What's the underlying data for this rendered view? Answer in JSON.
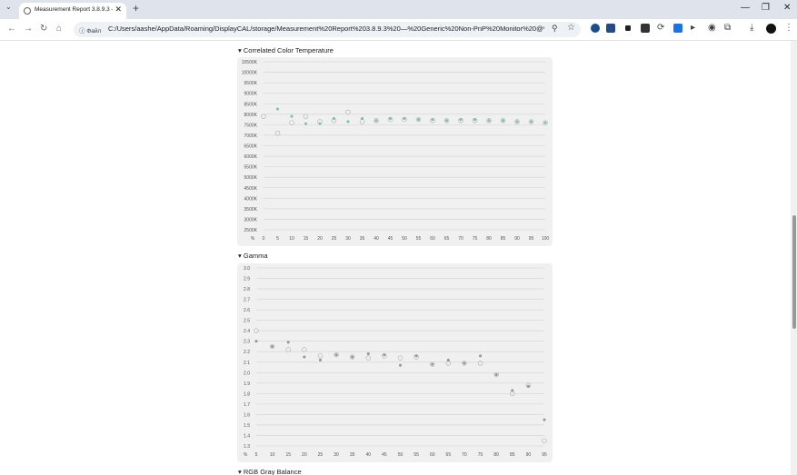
{
  "browser": {
    "tab_title": "Measurement Report 3.8.9.3 —",
    "site_label": "Файл",
    "url": "C:/Users/aashe/AppData/Roaming/DisplayCAL/storage/Measurement%20Report%203.8.9.3%20—%20Generic%20Non-PnP%20Monitor%20@%20384...",
    "ext_colors": [
      "#1a4e8a",
      "#264a86",
      "#202124",
      "#333333",
      "#1b73e8",
      "#5f6368",
      "#5f6368"
    ]
  },
  "sections": {
    "cct_title": "Correlated Color Temperature",
    "gamma_title": "Gamma",
    "rgb_title": "RGB Gray Balance"
  },
  "chart_data": [
    {
      "type": "scatter",
      "title": "Correlated Color Temperature",
      "ylim": [
        2500,
        10500
      ],
      "y_ticks": [
        "2500K",
        "3000K",
        "3500K",
        "4000K",
        "4500K",
        "5000K",
        "5500K",
        "6000K",
        "6500K",
        "7000K",
        "7500K",
        "8000K",
        "8500K",
        "9000K",
        "9500K",
        "10000K",
        "10500K"
      ],
      "x_ticks": [
        "%",
        "0",
        "5",
        "10",
        "15",
        "20",
        "25",
        "30",
        "35",
        "40",
        "45",
        "50",
        "55",
        "60",
        "65",
        "70",
        "75",
        "80",
        "85",
        "90",
        "95",
        "100"
      ],
      "grid": true,
      "series": [
        {
          "values": [
            [
              0,
              7900
            ],
            [
              5,
              7100
            ],
            [
              10,
              7600
            ],
            [
              15,
              7900
            ],
            [
              20,
              7650
            ],
            [
              25,
              7700
            ],
            [
              30,
              8100
            ],
            [
              35,
              7650
            ],
            [
              40,
              7700
            ],
            [
              45,
              7750
            ],
            [
              50,
              7750
            ],
            [
              55,
              7750
            ],
            [
              60,
              7700
            ],
            [
              65,
              7700
            ],
            [
              70,
              7700
            ],
            [
              75,
              7700
            ],
            [
              80,
              7700
            ],
            [
              85,
              7700
            ],
            [
              90,
              7650
            ],
            [
              95,
              7650
            ],
            [
              100,
              7600
            ]
          ]
        },
        {
          "values": [
            [
              5,
              8250
            ],
            [
              10,
              7900
            ],
            [
              15,
              7550
            ],
            [
              20,
              7550
            ],
            [
              25,
              7800
            ],
            [
              30,
              7650
            ],
            [
              35,
              7800
            ],
            [
              40,
              7700
            ],
            [
              45,
              7800
            ],
            [
              50,
              7800
            ],
            [
              55,
              7750
            ],
            [
              60,
              7750
            ],
            [
              65,
              7700
            ],
            [
              70,
              7750
            ],
            [
              75,
              7750
            ],
            [
              80,
              7700
            ],
            [
              85,
              7700
            ],
            [
              90,
              7650
            ],
            [
              95,
              7650
            ],
            [
              100,
              7600
            ]
          ]
        }
      ]
    },
    {
      "type": "scatter",
      "title": "Gamma",
      "ylim": [
        1.3,
        3.0
      ],
      "y_ticks": [
        "1.3",
        "1.4",
        "1.5",
        "1.6",
        "1.7",
        "1.8",
        "1.9",
        "2.0",
        "2.1",
        "2.2",
        "2.3",
        "2.4",
        "2.5",
        "2.6",
        "2.7",
        "2.8",
        "2.9",
        "3.0"
      ],
      "x_ticks": [
        "%",
        "5",
        "10",
        "15",
        "20",
        "25",
        "30",
        "35",
        "40",
        "45",
        "50",
        "55",
        "60",
        "65",
        "70",
        "75",
        "80",
        "85",
        "90",
        "95"
      ],
      "grid": true,
      "series": [
        {
          "values": [
            [
              5,
              2.4
            ],
            [
              10,
              2.25
            ],
            [
              15,
              2.22
            ],
            [
              20,
              2.22
            ],
            [
              25,
              2.16
            ],
            [
              30,
              2.17
            ],
            [
              35,
              2.15
            ],
            [
              40,
              2.14
            ],
            [
              45,
              2.16
            ],
            [
              50,
              2.14
            ],
            [
              55,
              2.15
            ],
            [
              60,
              2.08
            ],
            [
              65,
              2.09
            ],
            [
              70,
              2.09
            ],
            [
              75,
              2.09
            ],
            [
              80,
              1.98
            ],
            [
              85,
              1.8
            ],
            [
              90,
              1.88
            ],
            [
              95,
              1.35
            ]
          ]
        },
        {
          "values": [
            [
              5,
              2.3
            ],
            [
              10,
              2.25
            ],
            [
              15,
              2.29
            ],
            [
              20,
              2.15
            ],
            [
              25,
              2.12
            ],
            [
              30,
              2.17
            ],
            [
              35,
              2.15
            ],
            [
              40,
              2.18
            ],
            [
              45,
              2.17
            ],
            [
              50,
              2.07
            ],
            [
              55,
              2.16
            ],
            [
              60,
              2.08
            ],
            [
              65,
              2.12
            ],
            [
              70,
              2.09
            ],
            [
              75,
              2.16
            ],
            [
              80,
              1.98
            ],
            [
              85,
              1.83
            ],
            [
              90,
              1.87
            ],
            [
              95,
              1.55
            ]
          ]
        }
      ]
    }
  ]
}
